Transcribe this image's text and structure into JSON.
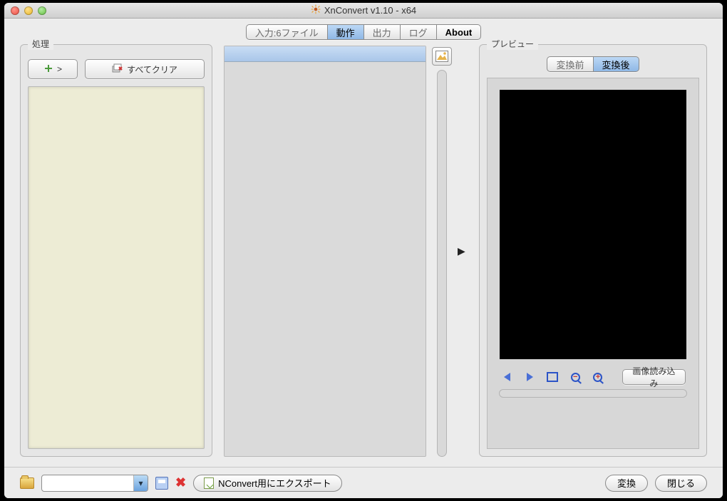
{
  "window": {
    "title": "XnConvert v1.10 - x64"
  },
  "tabs": {
    "input": "入力:6ファイル",
    "action": "動作",
    "output": "出力",
    "log": "ログ",
    "about": "About"
  },
  "processing": {
    "label": "処理",
    "add_button": ">",
    "clear_all": "すべてクリア"
  },
  "preview": {
    "label": "プレビュー",
    "before": "変換前",
    "after": "変換後",
    "reload": "画像読み込み"
  },
  "bottom": {
    "export": "NConvert用にエクスポート",
    "convert": "変換",
    "close": "閉じる"
  }
}
